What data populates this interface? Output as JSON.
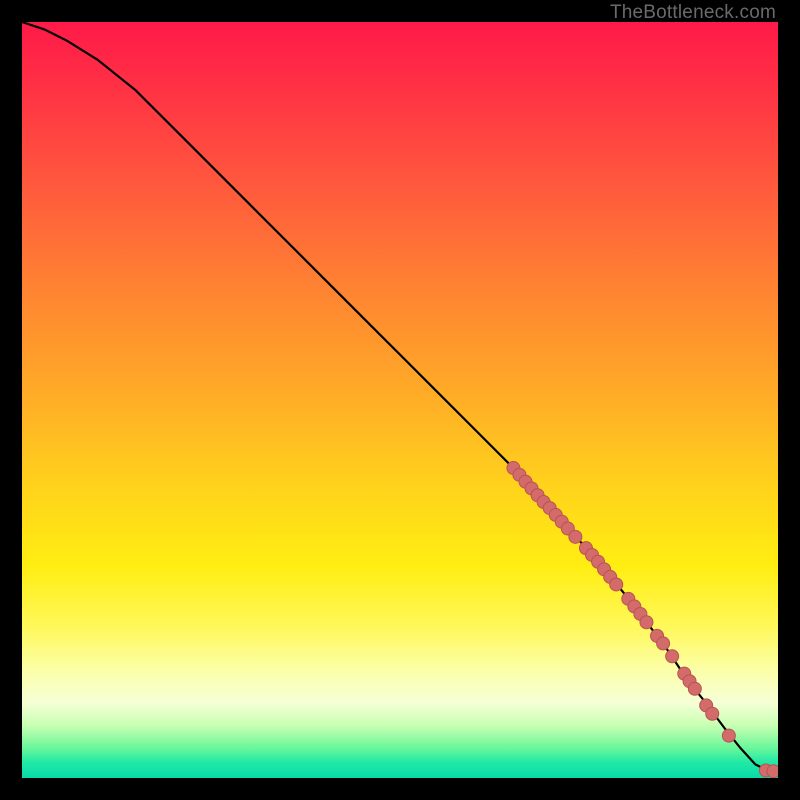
{
  "watermark": "TheBottleneck.com",
  "colors": {
    "dot_fill": "#d46b6b",
    "dot_stroke": "#b85353",
    "line": "#000000"
  },
  "chart_data": {
    "type": "line",
    "title": "",
    "xlabel": "",
    "ylabel": "",
    "xlim": [
      0,
      100
    ],
    "ylim": [
      0,
      100
    ],
    "grid": false,
    "legend": false,
    "series": [
      {
        "name": "curve",
        "x": [
          0,
          3,
          6,
          10,
          15,
          20,
          30,
          40,
          50,
          60,
          65,
          70,
          75,
          80,
          85,
          88,
          90,
          93,
          95,
          97,
          99,
          100
        ],
        "y": [
          100,
          99,
          97.5,
          95,
          91,
          86,
          76,
          66,
          56,
          46,
          41,
          35.5,
          30,
          24,
          17.5,
          13,
          10.5,
          6.5,
          4,
          1.8,
          0.8,
          0.8
        ]
      }
    ],
    "markers": [
      {
        "x": 65.0,
        "y": 41.0
      },
      {
        "x": 65.8,
        "y": 40.1
      },
      {
        "x": 66.6,
        "y": 39.2
      },
      {
        "x": 67.4,
        "y": 38.3
      },
      {
        "x": 68.2,
        "y": 37.4
      },
      {
        "x": 69.0,
        "y": 36.5
      },
      {
        "x": 69.8,
        "y": 35.7
      },
      {
        "x": 70.6,
        "y": 34.8
      },
      {
        "x": 71.4,
        "y": 33.9
      },
      {
        "x": 72.2,
        "y": 33.0
      },
      {
        "x": 73.2,
        "y": 31.9
      },
      {
        "x": 74.6,
        "y": 30.4
      },
      {
        "x": 75.4,
        "y": 29.5
      },
      {
        "x": 76.2,
        "y": 28.6
      },
      {
        "x": 77.0,
        "y": 27.6
      },
      {
        "x": 77.8,
        "y": 26.6
      },
      {
        "x": 78.6,
        "y": 25.6
      },
      {
        "x": 80.2,
        "y": 23.7
      },
      {
        "x": 81.0,
        "y": 22.7
      },
      {
        "x": 81.8,
        "y": 21.7
      },
      {
        "x": 82.6,
        "y": 20.6
      },
      {
        "x": 84.0,
        "y": 18.8
      },
      {
        "x": 84.8,
        "y": 17.8
      },
      {
        "x": 86.0,
        "y": 16.1
      },
      {
        "x": 87.6,
        "y": 13.8
      },
      {
        "x": 88.3,
        "y": 12.8
      },
      {
        "x": 89.0,
        "y": 11.8
      },
      {
        "x": 90.5,
        "y": 9.6
      },
      {
        "x": 91.3,
        "y": 8.5
      },
      {
        "x": 93.5,
        "y": 5.6
      },
      {
        "x": 98.4,
        "y": 1.0
      },
      {
        "x": 99.4,
        "y": 0.9
      }
    ]
  }
}
